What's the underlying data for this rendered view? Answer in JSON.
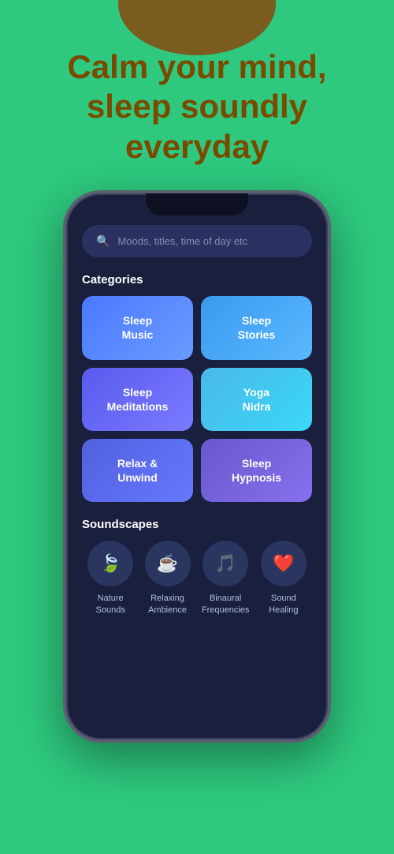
{
  "background_color": "#2ec97e",
  "hero": {
    "title": "Calm your mind, sleep soundly everyday",
    "title_color": "#7a4a00"
  },
  "phone": {
    "search": {
      "placeholder": "Moods, titles, time of day etc"
    },
    "categories_label": "Categories",
    "categories": [
      {
        "id": "sleep-music",
        "label": "Sleep\nMusic",
        "style": "blue"
      },
      {
        "id": "sleep-stories",
        "label": "Sleep\nStories",
        "style": "teal"
      },
      {
        "id": "sleep-meditations",
        "label": "Sleep\nMeditations",
        "style": "purple"
      },
      {
        "id": "yoga-nidra",
        "label": "Yoga\nNidra",
        "style": "cyan"
      },
      {
        "id": "relax-unwind",
        "label": "Relax &\nUnwind",
        "style": "indigo"
      },
      {
        "id": "sleep-hypnosis",
        "label": "Sleep\nHypnosis",
        "style": "violet"
      }
    ],
    "soundscapes_label": "Soundscapes",
    "soundscapes": [
      {
        "id": "nature-sounds",
        "icon": "🍃",
        "label": "Nature\nSounds"
      },
      {
        "id": "relaxing-ambience",
        "icon": "☕",
        "label": "Relaxing\nAmbience"
      },
      {
        "id": "binaural-frequencies",
        "icon": "🎵",
        "label": "Binaural\nFrequencies"
      },
      {
        "id": "sound-healing",
        "icon": "❤",
        "label": "Sound\nHealing"
      }
    ]
  }
}
